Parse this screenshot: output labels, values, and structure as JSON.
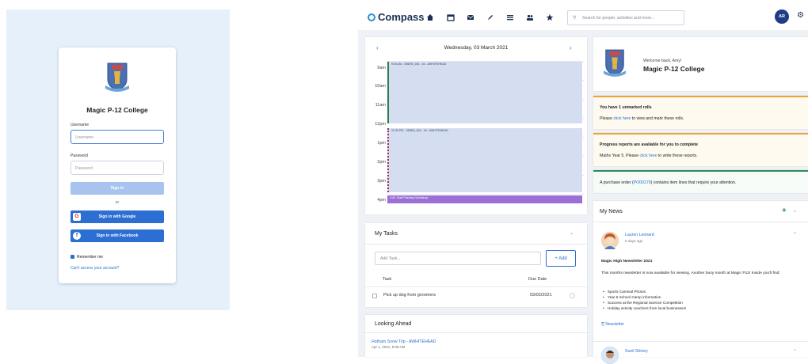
{
  "login": {
    "school_name": "Magic P-12 College",
    "username_label": "Username",
    "username_placeholder": "Username",
    "password_label": "Password",
    "password_placeholder": "Password",
    "signin_label": "Sign in",
    "or_label": "or",
    "google_label": "Sign in with Google",
    "facebook_label": "Sign in with Facebook",
    "remember_label": "Remember me",
    "cant_access_label": "Can't access your account?"
  },
  "topbar": {
    "app_name": "Compass",
    "nav_icons": [
      "home-icon",
      "calendar-icon",
      "mail-icon",
      "pencil-icon",
      "list-icon",
      "people-icon",
      "star-icon"
    ],
    "search_placeholder": "Search for people, activities and more...",
    "user_initials": "AR",
    "colors": {
      "brand": "#1b2f52",
      "accent": "#2c6ed1",
      "avatar": "#1f3c86"
    }
  },
  "calendar": {
    "date_label": "Wednesday, 03 March 2021",
    "hours": [
      "9am",
      "10am",
      "11am",
      "12pm",
      "1pm",
      "2pm",
      "3pm",
      "4pm"
    ],
    "events": [
      {
        "label": "9:00 AM - 056EN_004 - 04 - AWHITEHEAD",
        "color": "#d5def0",
        "border": "#2e7d4a"
      },
      {
        "label": "12:30 PM - 056EN_004 - 04 - AWHITEHEAD",
        "color": "#d5def0",
        "border": "#a0295a"
      },
      {
        "label": "4:00: Staff Planning Workshop",
        "color": "#9b6fd6",
        "border": "#9b6fd6"
      }
    ]
  },
  "tasks": {
    "title": "My Tasks",
    "input_placeholder": "Add Task...",
    "add_label": "+ Add",
    "col_task": "Task",
    "col_due": "Due Date",
    "rows": [
      {
        "task": "Pick up dog from groomers",
        "due": "03/02/2021"
      }
    ]
  },
  "looking_ahead": {
    "title": "Looking Ahead",
    "items": [
      {
        "title": "Hotham Snow Trip - AWHITEHEAD",
        "time": "Apr 1, 2021, 9:00 AM"
      }
    ]
  },
  "welcome": {
    "greeting": "Welcome back, Amy!",
    "school": "Magic P-12 College"
  },
  "alerts": [
    {
      "title": "You have 1 unmarked rolls",
      "pre": "Please ",
      "link": "click here",
      "post": " to view and mark these rolls.",
      "color": "#f0a23a"
    },
    {
      "title": "Progress reports are available for you to complete",
      "pre": "Maths Year 5. Please ",
      "link": "click here",
      "post": " to write these reports.",
      "color": "#f0a23a"
    },
    {
      "title": "",
      "pre": "A purchase order (",
      "link": "PO00179",
      "post": ") contains item lines that require your attention.",
      "color": "#2e8b57"
    }
  ],
  "news": {
    "title": "My News",
    "items": [
      {
        "author": "Lauren Leonard",
        "time": "6 days ago",
        "headline": "Magic High Newsletter 2021",
        "body": "This months newsletter is now available for viewing. Another busy month at Magic P12! Inside you'll find:",
        "bullets": [
          "Sports Carnival Photos",
          "Year 6 School Camp information",
          "Success at the Regional Science Competition",
          "Holiday activity vouchers from local businesses!"
        ],
        "attachment": "Newsletter"
      },
      {
        "author": "Sunil Shiney"
      }
    ]
  }
}
